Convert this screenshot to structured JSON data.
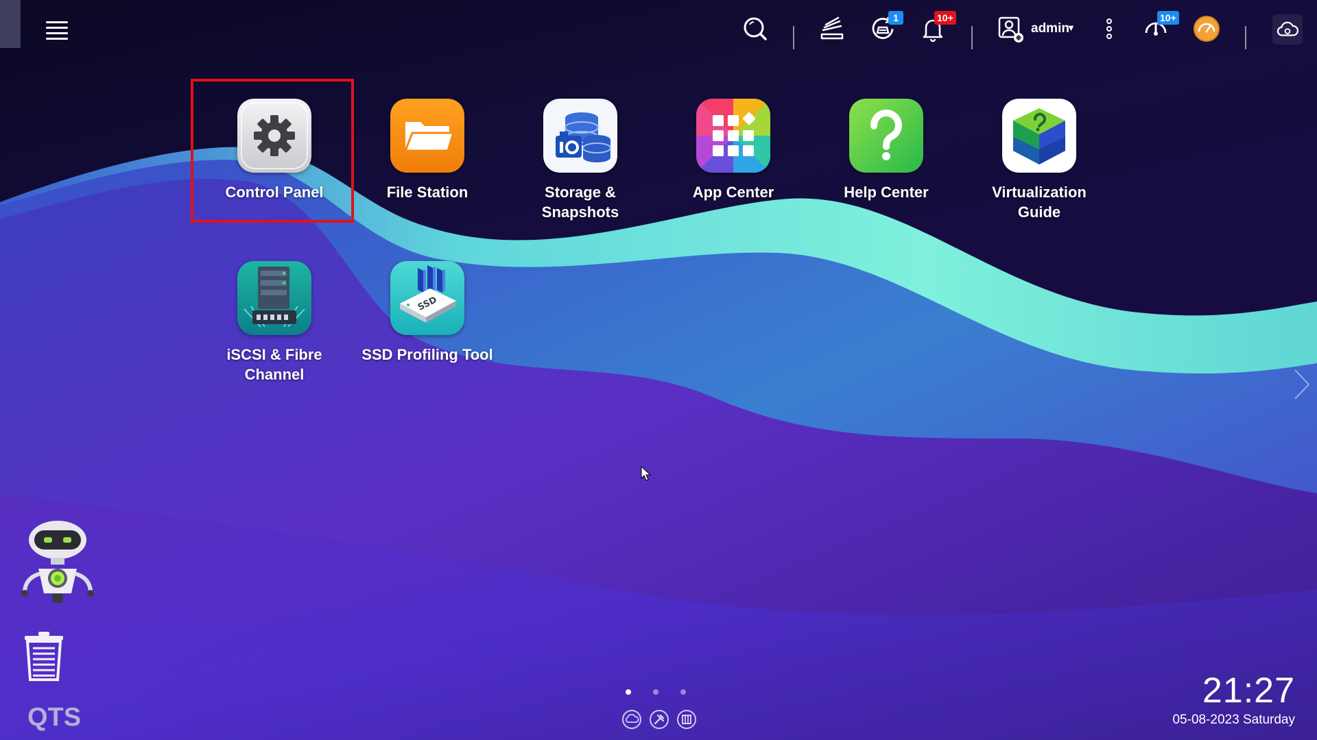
{
  "topbar": {
    "username": "admin",
    "badges": {
      "background_tasks": "1",
      "notifications": "10+",
      "firmware": "10+"
    },
    "badge_colors": {
      "blue": "#1d8bf0",
      "red": "#e0121b"
    }
  },
  "apps": [
    {
      "label": "Control Panel",
      "icon": "gear-icon"
    },
    {
      "label": "File Station",
      "icon": "folder-icon"
    },
    {
      "label": "Storage & Snapshots",
      "icon": "storage-icon"
    },
    {
      "label": "App Center",
      "icon": "app-grid-icon"
    },
    {
      "label": "Help Center",
      "icon": "question-icon"
    },
    {
      "label": "Virtualization Guide",
      "icon": "cube-icon"
    },
    {
      "label": "iSCSI & Fibre Channel",
      "icon": "server-icon"
    },
    {
      "label": "SSD Profiling Tool",
      "icon": "ssd-icon"
    }
  ],
  "clock": {
    "time": "21:27",
    "date": "05-08-2023 Saturday"
  },
  "brand": "QTS",
  "pager": {
    "pages": 3,
    "active": 1
  },
  "colors": {
    "highlight": "#e0121b",
    "accent_teal": "#6ee0d8",
    "bg_dark": "#12082e"
  }
}
